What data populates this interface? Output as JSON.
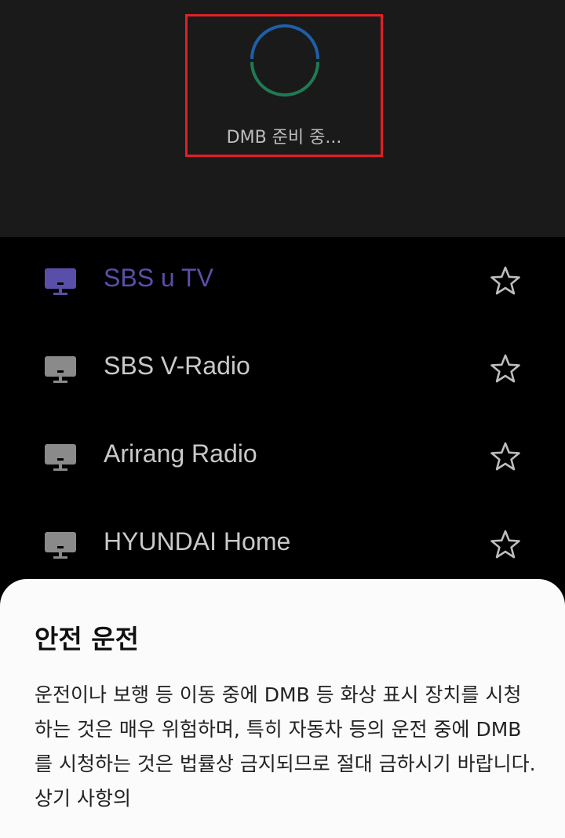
{
  "player": {
    "loading_text": "DMB 준비 중..."
  },
  "channels": [
    {
      "name": "SBS u TV",
      "active": true
    },
    {
      "name": "SBS V-Radio",
      "active": false
    },
    {
      "name": "Arirang Radio",
      "active": false
    },
    {
      "name": "HYUNDAI Home",
      "active": false
    }
  ],
  "colors": {
    "active_channel": "#5a4fa8",
    "highlight_border": "#e02027",
    "spinner_top": "#1e5fa8",
    "spinner_bottom": "#1f7a55"
  },
  "safety_sheet": {
    "title": "안전 운전",
    "body": "운전이나 보행 등 이동 중에 DMB 등 화상 표시 장치를 시청하는 것은 매우 위험하며, 특히 자동차 등의 운전 중에 DMB를 시청하는 것은 법률상 금지되므로 절대 금하시기 바랍니다. 상기 사항의"
  }
}
